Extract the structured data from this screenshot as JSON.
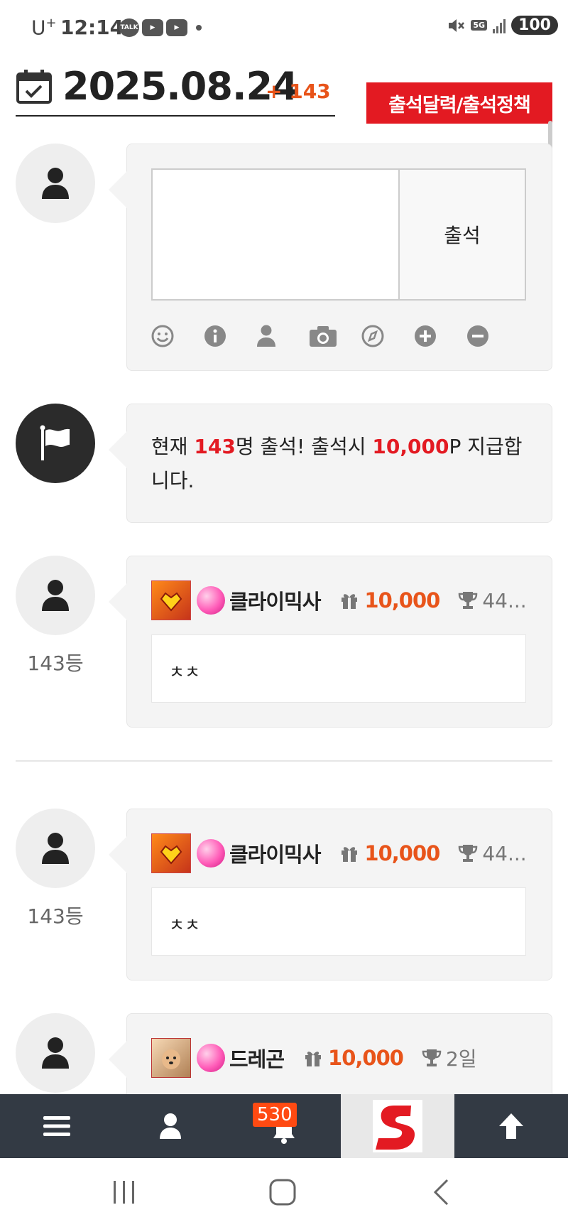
{
  "status_bar": {
    "carrier": "U",
    "carrier_sup": "+",
    "time": "12:14",
    "talk_label": "TALK",
    "net_label": "5G",
    "battery": "100"
  },
  "header": {
    "date": "2025.08.24",
    "delta": "+ 143",
    "calendar_button": "출석달력/출석정책"
  },
  "compose": {
    "input_value": "",
    "submit_label": "출석",
    "tools": [
      "emoji-icon",
      "info-icon",
      "user-icon",
      "camera-icon",
      "compass-icon",
      "plus-circle-icon",
      "minus-circle-icon"
    ]
  },
  "notice": {
    "prefix": "현재 ",
    "count": "143",
    "middle": "명 출석! 출석시 ",
    "points": "10,000",
    "suffix": "P 지급합니다."
  },
  "entries": [
    {
      "nickname": "클라이믹사",
      "points": "10,000",
      "days": "44...",
      "rank": "143등",
      "comment": "ㅊㅊ"
    },
    {
      "nickname": "클라이믹사",
      "points": "10,000",
      "days": "44...",
      "rank": "143등",
      "comment": "ㅊㅊ"
    },
    {
      "nickname": "드레곤",
      "points": "10,000",
      "days": "2일",
      "rank": "",
      "comment": ""
    }
  ],
  "bottom_nav": {
    "notification_count": "530",
    "logo_letter": "S"
  },
  "colors": {
    "accent_red": "#e31a22",
    "points_orange": "#e8541a",
    "nav_bg": "#333a44"
  }
}
